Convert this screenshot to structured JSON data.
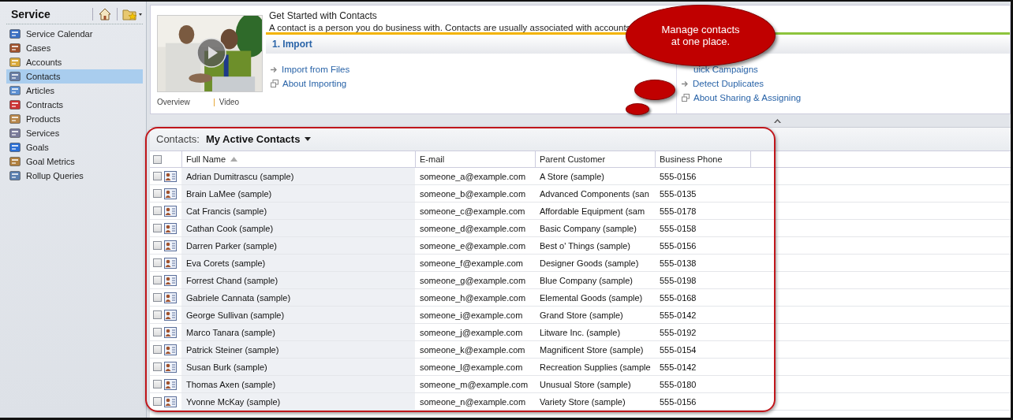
{
  "sidebar": {
    "title": "Service",
    "items": [
      {
        "label": "Service Calendar",
        "selected": false
      },
      {
        "label": "Cases",
        "selected": false
      },
      {
        "label": "Accounts",
        "selected": false
      },
      {
        "label": "Contacts",
        "selected": true
      },
      {
        "label": "Articles",
        "selected": false
      },
      {
        "label": "Contracts",
        "selected": false
      },
      {
        "label": "Products",
        "selected": false
      },
      {
        "label": "Services",
        "selected": false
      },
      {
        "label": "Goals",
        "selected": false
      },
      {
        "label": "Goal Metrics",
        "selected": false
      },
      {
        "label": "Rollup Queries",
        "selected": false
      }
    ]
  },
  "get_started": {
    "media": {
      "links": [
        "Overview",
        "Video"
      ]
    },
    "title": "Get Started with Contacts",
    "description": "A contact is a person you do business with. Contacts are usually associated with accounts",
    "sections": [
      {
        "heading": "1. Import",
        "links": [
          {
            "label": "Import from Files",
            "kind": "action"
          },
          {
            "label": "About Importing",
            "kind": "help"
          }
        ]
      },
      {
        "links": [
          {
            "label": "uick Campaigns",
            "kind": "cut"
          },
          {
            "label": "Detect Duplicates",
            "kind": "action"
          },
          {
            "label": "About Sharing & Assigning",
            "kind": "help"
          }
        ]
      }
    ]
  },
  "callout": {
    "text": "Manage contacts at one place."
  },
  "grid": {
    "view_label": "Contacts:",
    "view_name": "My Active Contacts",
    "all_checked": false,
    "columns": [
      {
        "label": "Full Name",
        "sorted": true
      },
      {
        "label": "E-mail"
      },
      {
        "label": "Parent Customer"
      },
      {
        "label": "Business Phone"
      }
    ],
    "rows": [
      {
        "checked": false,
        "name": "Adrian Dumitrascu (sample)",
        "email": "someone_a@example.com",
        "parent": "A Store (sample)",
        "phone": "555-0156"
      },
      {
        "checked": false,
        "name": "Brain LaMee (sample)",
        "email": "someone_b@example.com",
        "parent": "Advanced Components (san",
        "phone": "555-0135"
      },
      {
        "checked": false,
        "name": "Cat Francis (sample)",
        "email": "someone_c@example.com",
        "parent": "Affordable Equipment (sam",
        "phone": "555-0178"
      },
      {
        "checked": false,
        "name": "Cathan Cook (sample)",
        "email": "someone_d@example.com",
        "parent": "Basic Company (sample)",
        "phone": "555-0158"
      },
      {
        "checked": false,
        "name": "Darren Parker (sample)",
        "email": "someone_e@example.com",
        "parent": "Best o' Things (sample)",
        "phone": "555-0156"
      },
      {
        "checked": false,
        "name": "Eva Corets (sample)",
        "email": "someone_f@example.com",
        "parent": "Designer Goods (sample)",
        "phone": "555-0138"
      },
      {
        "checked": false,
        "name": "Forrest Chand (sample)",
        "email": "someone_g@example.com",
        "parent": "Blue Company (sample)",
        "phone": "555-0198"
      },
      {
        "checked": false,
        "name": "Gabriele Cannata (sample)",
        "email": "someone_h@example.com",
        "parent": "Elemental Goods (sample)",
        "phone": "555-0168"
      },
      {
        "checked": false,
        "name": "George Sullivan (sample)",
        "email": "someone_i@example.com",
        "parent": "Grand Store (sample)",
        "phone": "555-0142"
      },
      {
        "checked": false,
        "name": "Marco Tanara (sample)",
        "email": "someone_j@example.com",
        "parent": "Litware Inc. (sample)",
        "phone": "555-0192"
      },
      {
        "checked": false,
        "name": "Patrick Steiner (sample)",
        "email": "someone_k@example.com",
        "parent": "Magnificent Store (sample)",
        "phone": "555-0154"
      },
      {
        "checked": false,
        "name": "Susan Burk (sample)",
        "email": "someone_l@example.com",
        "parent": "Recreation Supplies (sample",
        "phone": "555-0142"
      },
      {
        "checked": false,
        "name": "Thomas Axen (sample)",
        "email": "someone_m@example.com",
        "parent": "Unusual Store (sample)",
        "phone": "555-0180"
      },
      {
        "checked": false,
        "name": "Yvonne McKay (sample)",
        "email": "someone_n@example.com",
        "parent": "Variety Store (sample)",
        "phone": "555-0156"
      }
    ]
  }
}
